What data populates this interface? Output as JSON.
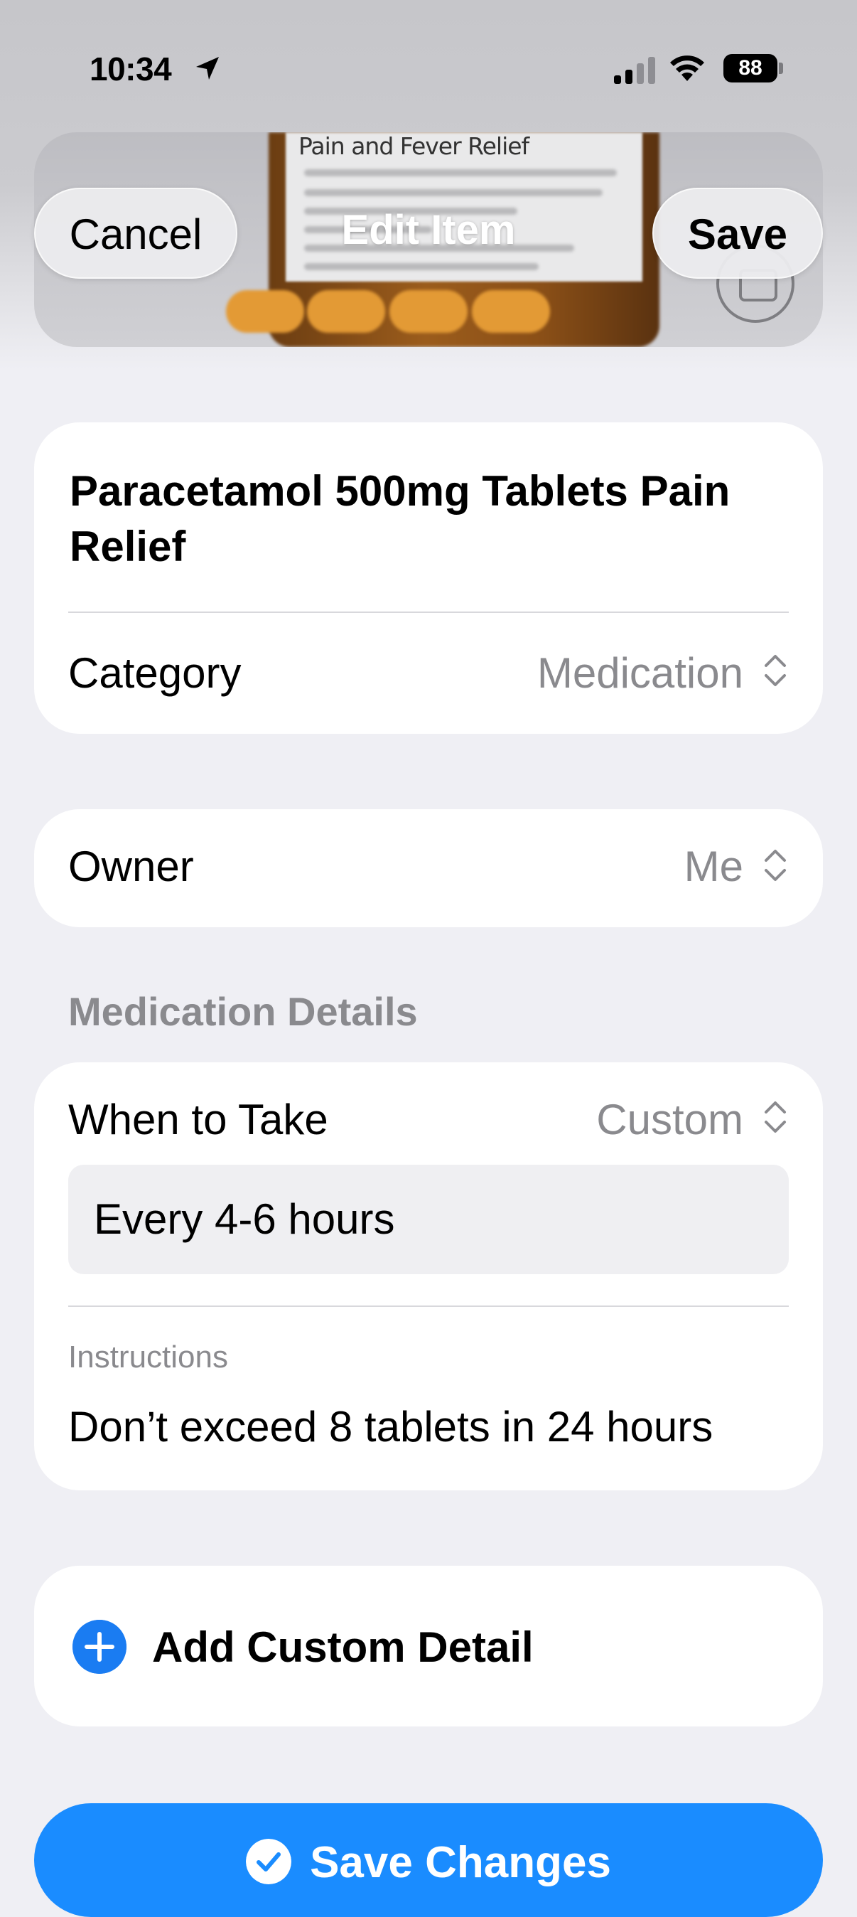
{
  "status_bar": {
    "time": "10:34",
    "battery": "88"
  },
  "nav": {
    "cancel_label": "Cancel",
    "title": "Edit Item",
    "save_label": "Save"
  },
  "photo": {
    "label_text": "Pain and Fever Relief"
  },
  "item": {
    "name": "Paracetamol 500mg Tablets Pain Relief",
    "category_label": "Category",
    "category_value": "Medication"
  },
  "owner": {
    "label": "Owner",
    "value": "Me"
  },
  "medication_details": {
    "header": "Medication Details",
    "when_label": "When to Take",
    "when_value": "Custom",
    "custom_schedule": "Every 4-6 hours",
    "instructions_label": "Instructions",
    "instructions_value": "Don’t exceed 8 tablets in 24 hours"
  },
  "add_custom_detail": {
    "label": "Add Custom Detail"
  },
  "save_changes": {
    "label": "Save Changes"
  },
  "colors": {
    "accent": "#1a8cff",
    "plus_icon": "#1a7cf2",
    "secondary_text": "#8a8a8e",
    "background": "#efeff4"
  }
}
